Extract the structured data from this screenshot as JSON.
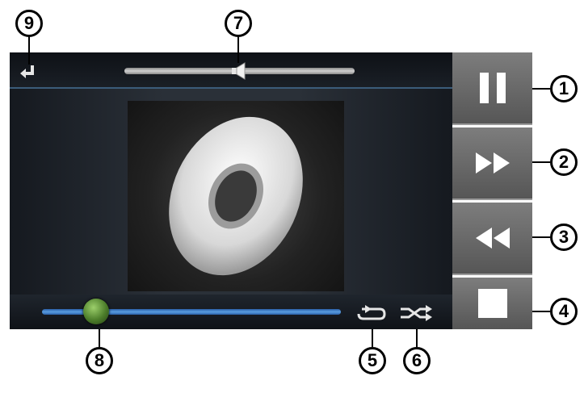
{
  "callouts": {
    "pause": "1",
    "next": "2",
    "previous": "3",
    "stop": "4",
    "repeat": "5",
    "shuffle": "6",
    "volume": "7",
    "seek": "8",
    "back": "9"
  },
  "player": {
    "volume_level": 0.48,
    "seek_position": 0.2
  },
  "colors": {
    "seek_track": "#4a88d0",
    "seek_knob": "#5f8f35",
    "side_button": "#6b6b6b",
    "top_bar_border": "#3b5c7a"
  },
  "icons": {
    "back": "return-arrow-icon",
    "volume": "speaker-icon",
    "album": "disc-icon",
    "repeat": "repeat-icon",
    "shuffle": "shuffle-icon",
    "pause": "pause-icon",
    "next": "fast-forward-icon",
    "previous": "rewind-icon",
    "stop": "stop-icon"
  }
}
